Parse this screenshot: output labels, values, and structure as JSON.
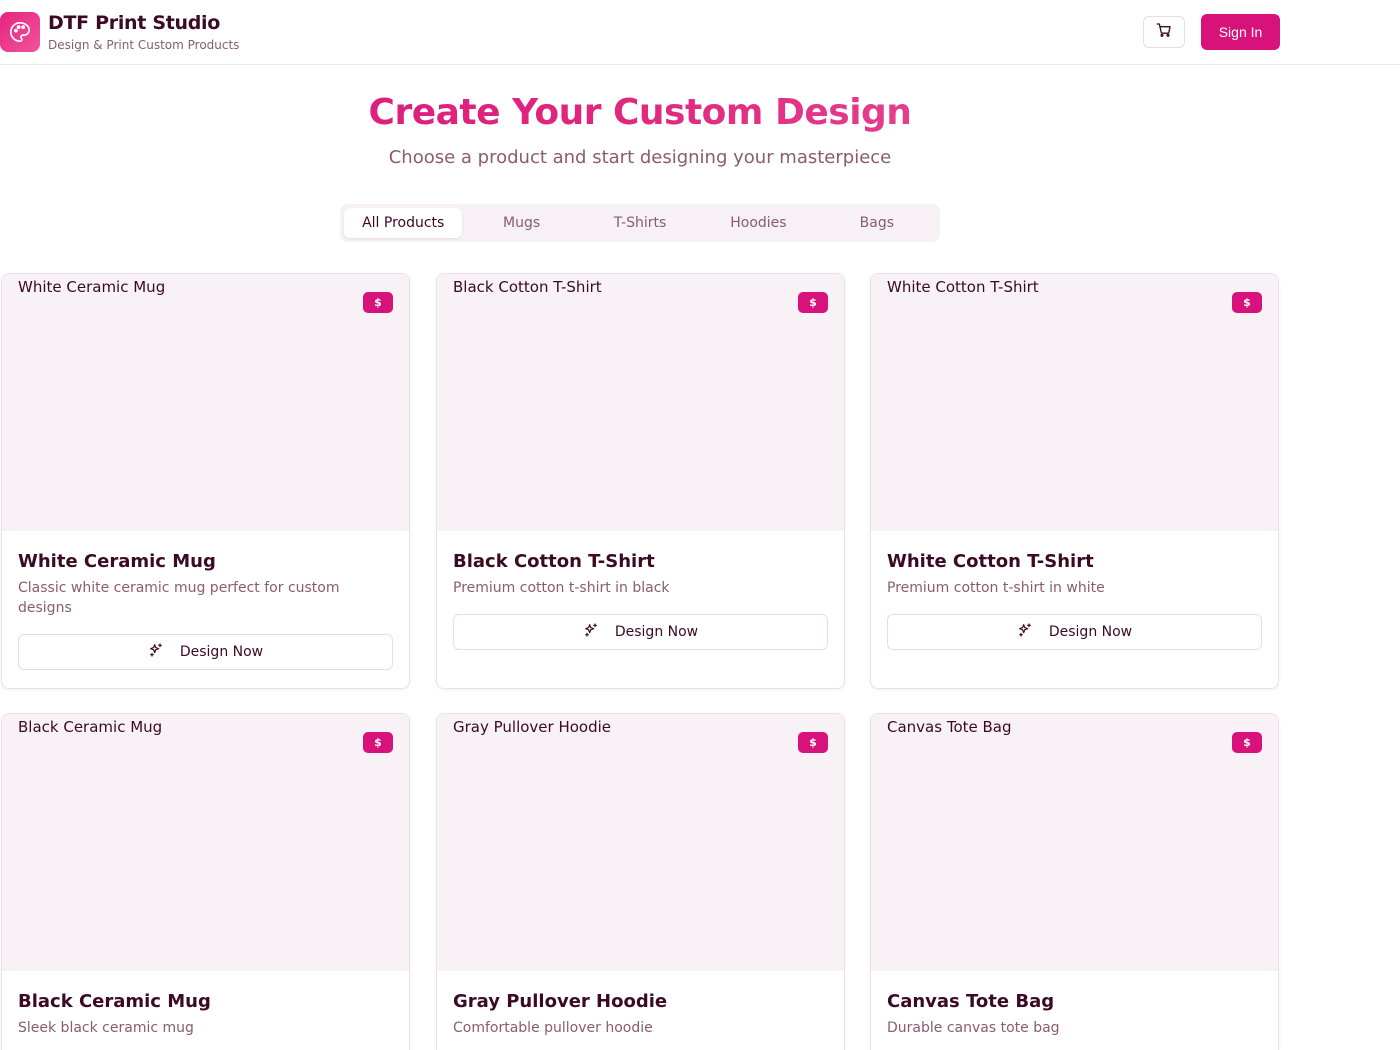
{
  "header": {
    "brand_title": "DTF Print Studio",
    "brand_subtitle": "Design & Print Custom Products",
    "logo_icon": "palette-icon",
    "cart_icon": "cart-icon",
    "signin_label": "Sign In"
  },
  "hero": {
    "title": "Create Your Custom Design",
    "subtitle": "Choose a product and start designing your masterpiece"
  },
  "tabs": [
    {
      "label": "All Products",
      "active": true
    },
    {
      "label": "Mugs",
      "active": false
    },
    {
      "label": "T-Shirts",
      "active": false
    },
    {
      "label": "Hoodies",
      "active": false
    },
    {
      "label": "Bags",
      "active": false
    }
  ],
  "products": [
    {
      "image_alt": "White Ceramic Mug",
      "price": "$",
      "title": "White Ceramic Mug",
      "description": "Classic white ceramic mug perfect for custom designs",
      "button": "Design Now"
    },
    {
      "image_alt": "Black Cotton T-Shirt",
      "price": "$",
      "title": "Black Cotton T-Shirt",
      "description": "Premium cotton t-shirt in black",
      "button": "Design Now"
    },
    {
      "image_alt": "White Cotton T-Shirt",
      "price": "$",
      "title": "White Cotton T-Shirt",
      "description": "Premium cotton t-shirt in white",
      "button": "Design Now"
    },
    {
      "image_alt": "Black Ceramic Mug",
      "price": "$",
      "title": "Black Ceramic Mug",
      "description": "Sleek black ceramic mug",
      "button": "Design Now"
    },
    {
      "image_alt": "Gray Pullover Hoodie",
      "price": "$",
      "title": "Gray Pullover Hoodie",
      "description": "Comfortable pullover hoodie",
      "button": "Design Now"
    },
    {
      "image_alt": "Canvas Tote Bag",
      "price": "$",
      "title": "Canvas Tote Bag",
      "description": "Durable canvas tote bag",
      "button": "Design Now"
    }
  ],
  "colors": {
    "accent": "#d8127b",
    "text_dark": "#3b0a24",
    "text_muted": "#8a5b72",
    "image_bg": "#f8f2f6"
  }
}
